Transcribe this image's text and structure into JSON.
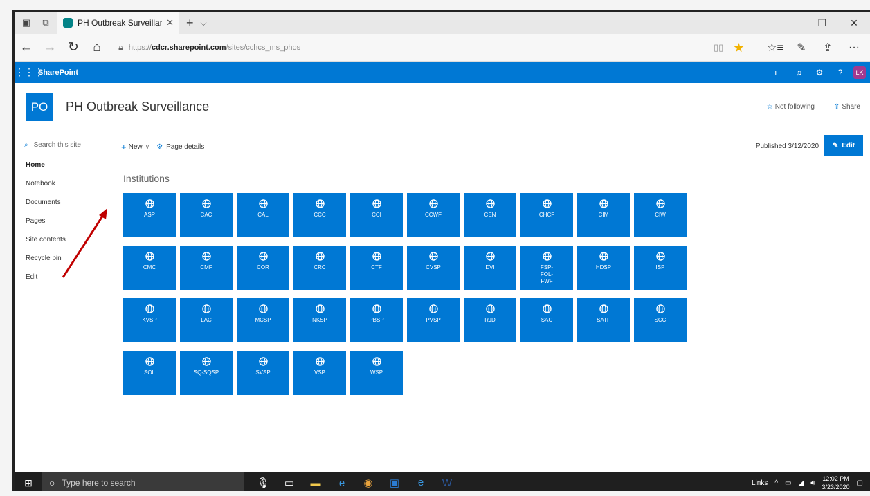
{
  "browser": {
    "tab_title": "PH Outbreak Surveillanc",
    "url_protocol": "https://",
    "url_host": "cdcr.sharepoint.com",
    "url_path": "/sites/cchcs_ms_phos"
  },
  "suite": {
    "brand": "SharePoint",
    "avatar_initials": "LK"
  },
  "site": {
    "logo": "PO",
    "title": "PH Outbreak Surveillance",
    "not_following": "Not following",
    "share": "Share"
  },
  "nav": {
    "search_placeholder": "Search this site",
    "items": [
      {
        "label": "Home"
      },
      {
        "label": "Notebook"
      },
      {
        "label": "Documents"
      },
      {
        "label": "Pages"
      },
      {
        "label": "Site contents"
      },
      {
        "label": "Recycle bin"
      },
      {
        "label": "Edit"
      }
    ]
  },
  "command": {
    "new_label": "New",
    "page_details": "Page details",
    "published": "Published 3/12/2020",
    "edit_label": "Edit"
  },
  "section": {
    "title": "Institutions"
  },
  "tiles": [
    "ASP",
    "CAC",
    "CAL",
    "CCC",
    "CCI",
    "CCWF",
    "CEN",
    "CHCF",
    "CIM",
    "CIW",
    "CMC",
    "CMF",
    "COR",
    "CRC",
    "CTF",
    "CVSP",
    "DVI",
    "FSP-FOL-FWF",
    "HDSP",
    "ISP",
    "KVSP",
    "LAC",
    "MCSP",
    "NKSP",
    "PBSP",
    "PVSP",
    "RJD",
    "SAC",
    "SATF",
    "SCC",
    "SOL",
    "SQ-SQSP",
    "SVSP",
    "VSP",
    "WSP"
  ],
  "taskbar": {
    "search_placeholder": "Type here to search",
    "links": "Links",
    "time": "12:02 PM",
    "date": "3/23/2020"
  },
  "colors": {
    "accent": "#0078d4",
    "annotation_arrow": "#c00000"
  }
}
